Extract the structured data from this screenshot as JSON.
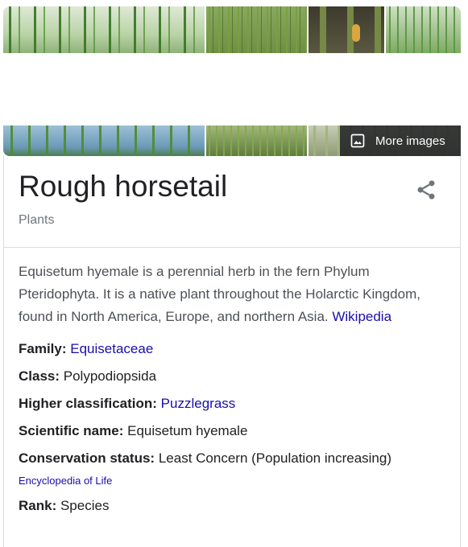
{
  "images": {
    "top_strip": [
      "stems-a",
      "stems-b",
      "stems-c",
      "stems-d"
    ],
    "bottom_strip": [
      "stems-e",
      "stems-f",
      "stems-g"
    ],
    "more_images_label": "More images",
    "more_images_icon": "image-icon"
  },
  "entity": {
    "title": "Rough horsetail",
    "subtitle": "Plants",
    "share_icon": "share-icon"
  },
  "description": {
    "text": "Equisetum hyemale is a perennial herb in the fern Phylum Pteridophyta. It is a native plant throughout the Holarctic Kingdom, found in North America, Europe, and northern Asia. ",
    "source_link": "Wikipedia"
  },
  "attributes": {
    "family_label": "Family:",
    "family_value": "Equisetaceae",
    "class_label": "Class:",
    "class_value": "Polypodiopsida",
    "higher_label": "Higher classification:",
    "higher_value": "Puzzlegrass",
    "scientific_label": "Scientific name:",
    "scientific_value": "Equisetum hyemale",
    "conservation_label": "Conservation status:",
    "conservation_value": "Least Concern (Population increasing)",
    "conservation_source": "Encyclopedia of Life",
    "rank_label": "Rank:",
    "rank_value": "Species"
  },
  "colors": {
    "link": "#1a0dab",
    "muted": "#70757a",
    "text": "#202124",
    "divider": "#dadce0"
  }
}
